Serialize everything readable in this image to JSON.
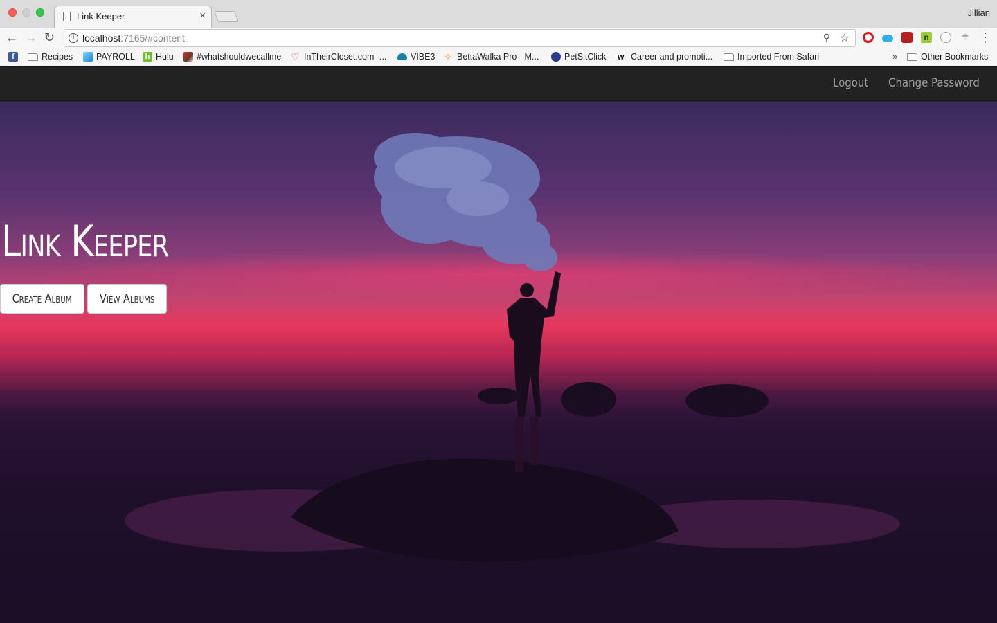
{
  "browser": {
    "tab_title": "Link Keeper",
    "tab_close": "×",
    "profile_name": "Jillian",
    "url_host": "localhost",
    "url_rest": ":7165/#content",
    "bookmarks": [
      {
        "label": "",
        "icon": "facebook-icon"
      },
      {
        "label": "Recipes",
        "icon": "folder-icon"
      },
      {
        "label": "PAYROLL",
        "icon": "payroll-icon"
      },
      {
        "label": "Hulu",
        "icon": "hulu-icon"
      },
      {
        "label": "#whatshouldwecallme",
        "icon": "image-icon"
      },
      {
        "label": "InTheirCloset.com -...",
        "icon": "heart-icon"
      },
      {
        "label": "VIBE3",
        "icon": "cloud-icon"
      },
      {
        "label": "BettaWalka Pro - M...",
        "icon": "walker-icon"
      },
      {
        "label": "PetSitClick",
        "icon": "petsitclick-icon"
      },
      {
        "label": "Career and promoti...",
        "icon": "w-icon"
      },
      {
        "label": "Imported From Safari",
        "icon": "folder-icon"
      },
      {
        "label": "Other Bookmarks",
        "icon": "folder-icon"
      }
    ],
    "overflow_label": "»"
  },
  "nav": {
    "logout": "Logout",
    "change_password": "Change Password"
  },
  "hero": {
    "title": "Link Keeper",
    "create_album": "Create Album",
    "view_albums": "View Albums"
  }
}
